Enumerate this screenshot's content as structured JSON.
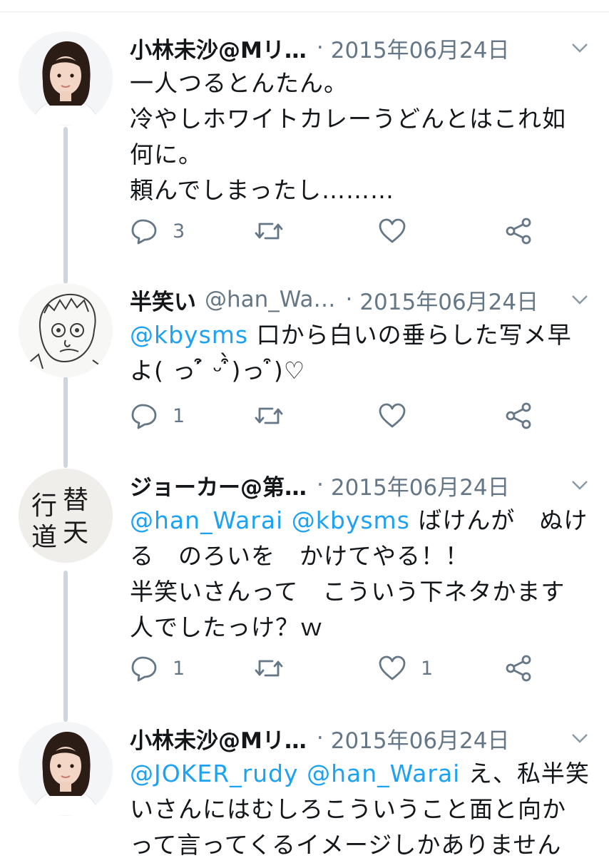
{
  "tweets": [
    {
      "name": "小林未沙@Mリ…",
      "handle": "",
      "dot": "·",
      "date": "2015年06月24日",
      "avatar_icon": "woman-portrait",
      "mentions": [],
      "text_lines": [
        "一人つるとんたん。",
        "冷やしホワイトカレーうどんとはこれ如",
        "何に。",
        "頼んでしまったし………"
      ],
      "reply_count": "3",
      "like_count": ""
    },
    {
      "name": "半笑い",
      "handle": "@han_Wa…",
      "dot": "·",
      "date": "2015年06月24日",
      "avatar_icon": "cartoon-face-drawing",
      "mentions": [
        "@kbysms"
      ],
      "text_lines": [
        " 口から白いの垂らした写メ早",
        "よ( っ ͒́ ᵕ ͒̀)っ ͒)♡"
      ],
      "reply_count": "1",
      "like_count": ""
    },
    {
      "name": "ジョーカー@第…",
      "handle": "",
      "dot": "·",
      "date": "2015年06月24日",
      "avatar_icon": "calligraphy-替天行道",
      "avatar_text": [
        "替",
        "天",
        "行",
        "道"
      ],
      "mentions": [
        "@han_Warai",
        "@kbysms"
      ],
      "text_lines": [
        " ばけんが　ぬけ",
        "る　のろいを　かけてやる！！",
        "半笑いさんって　こういう下ネタかます",
        "人でしたっけ？ｗ"
      ],
      "reply_count": "1",
      "like_count": "1"
    },
    {
      "name": "小林未沙@Mリ…",
      "handle": "",
      "dot": "·",
      "date": "2015年06月24日",
      "avatar_icon": "woman-portrait",
      "mentions": [
        "@JOKER_rudy",
        "@han_Warai"
      ],
      "text_lines": [
        " え、私半笑",
        "いさんにはむしろこういうこと面と向か",
        "って言ってくるイメージしかありません"
      ],
      "reply_count": "",
      "like_count": ""
    }
  ]
}
